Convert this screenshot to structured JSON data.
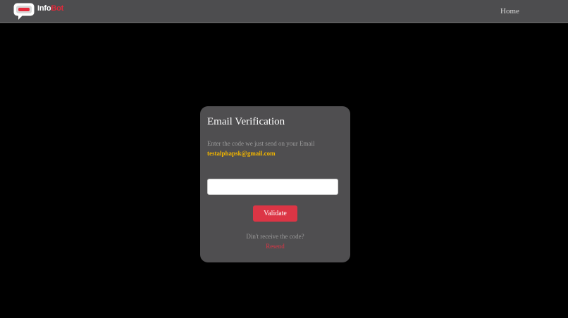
{
  "navbar": {
    "logo_prefix": "Info",
    "logo_suffix": "Bot",
    "home_label": "Home"
  },
  "colors": {
    "background": "#000000",
    "navbar": "#4d4d4f",
    "card": "#4f4e50",
    "accent_red": "#dc3545",
    "email_highlight": "#f0b400"
  },
  "verification": {
    "title": "Email Verification",
    "description": "Enter the code we just send on your Email",
    "email": "testalphapsk@gmail.com",
    "code_value": "",
    "validate_label": "Validate",
    "no_code_text": "Din't receive the code?",
    "resend_label": "Resend"
  }
}
